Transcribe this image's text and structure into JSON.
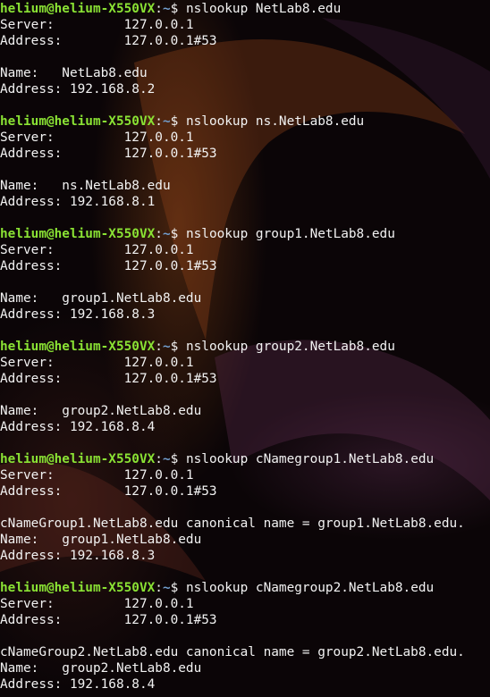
{
  "terminal": {
    "lines": [
      {
        "kind": "prompt",
        "user": "helium@helium-X550VX",
        "sep": ":",
        "path": "~",
        "cmd": "$ nslookup NetLab8.edu"
      },
      {
        "kind": "text",
        "text": "Server:\t\t127.0.0.1"
      },
      {
        "kind": "text",
        "text": "Address:\t127.0.0.1#53"
      },
      {
        "kind": "text",
        "text": ""
      },
      {
        "kind": "text",
        "text": "Name:\tNetLab8.edu"
      },
      {
        "kind": "text",
        "text": "Address: 192.168.8.2"
      },
      {
        "kind": "text",
        "text": ""
      },
      {
        "kind": "prompt",
        "user": "helium@helium-X550VX",
        "sep": ":",
        "path": "~",
        "cmd": "$ nslookup ns.NetLab8.edu"
      },
      {
        "kind": "text",
        "text": "Server:\t\t127.0.0.1"
      },
      {
        "kind": "text",
        "text": "Address:\t127.0.0.1#53"
      },
      {
        "kind": "text",
        "text": ""
      },
      {
        "kind": "text",
        "text": "Name:\tns.NetLab8.edu"
      },
      {
        "kind": "text",
        "text": "Address: 192.168.8.1"
      },
      {
        "kind": "text",
        "text": ""
      },
      {
        "kind": "prompt",
        "user": "helium@helium-X550VX",
        "sep": ":",
        "path": "~",
        "cmd": "$ nslookup group1.NetLab8.edu"
      },
      {
        "kind": "text",
        "text": "Server:\t\t127.0.0.1"
      },
      {
        "kind": "text",
        "text": "Address:\t127.0.0.1#53"
      },
      {
        "kind": "text",
        "text": ""
      },
      {
        "kind": "text",
        "text": "Name:\tgroup1.NetLab8.edu"
      },
      {
        "kind": "text",
        "text": "Address: 192.168.8.3"
      },
      {
        "kind": "text",
        "text": ""
      },
      {
        "kind": "prompt",
        "user": "helium@helium-X550VX",
        "sep": ":",
        "path": "~",
        "cmd": "$ nslookup group2.NetLab8.edu"
      },
      {
        "kind": "text",
        "text": "Server:\t\t127.0.0.1"
      },
      {
        "kind": "text",
        "text": "Address:\t127.0.0.1#53"
      },
      {
        "kind": "text",
        "text": ""
      },
      {
        "kind": "text",
        "text": "Name:\tgroup2.NetLab8.edu"
      },
      {
        "kind": "text",
        "text": "Address: 192.168.8.4"
      },
      {
        "kind": "text",
        "text": ""
      },
      {
        "kind": "prompt",
        "user": "helium@helium-X550VX",
        "sep": ":",
        "path": "~",
        "cmd": "$ nslookup cNamegroup1.NetLab8.edu"
      },
      {
        "kind": "text",
        "text": "Server:\t\t127.0.0.1"
      },
      {
        "kind": "text",
        "text": "Address:\t127.0.0.1#53"
      },
      {
        "kind": "text",
        "text": ""
      },
      {
        "kind": "text",
        "text": "cNameGroup1.NetLab8.edu canonical name = group1.NetLab8.edu."
      },
      {
        "kind": "text",
        "text": "Name:\tgroup1.NetLab8.edu"
      },
      {
        "kind": "text",
        "text": "Address: 192.168.8.3"
      },
      {
        "kind": "text",
        "text": ""
      },
      {
        "kind": "prompt",
        "user": "helium@helium-X550VX",
        "sep": ":",
        "path": "~",
        "cmd": "$ nslookup cNamegroup2.NetLab8.edu"
      },
      {
        "kind": "text",
        "text": "Server:\t\t127.0.0.1"
      },
      {
        "kind": "text",
        "text": "Address:\t127.0.0.1#53"
      },
      {
        "kind": "text",
        "text": ""
      },
      {
        "kind": "text",
        "text": "cNameGroup2.NetLab8.edu canonical name = group2.NetLab8.edu."
      },
      {
        "kind": "text",
        "text": "Name:\tgroup2.NetLab8.edu"
      },
      {
        "kind": "text",
        "text": "Address: 192.168.8.4"
      }
    ]
  },
  "colors": {
    "background": "#0b0507",
    "foreground": "#f2f2f2",
    "prompt_user": "#8ae234",
    "prompt_path": "#729fcf"
  }
}
